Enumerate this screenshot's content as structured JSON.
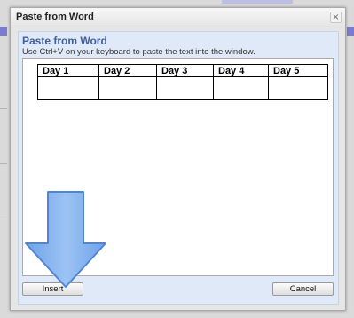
{
  "dialog": {
    "title": "Paste from Word",
    "close_glyph": "×",
    "heading": "Paste from Word",
    "instructions": "Use Ctrl+V on your keyboard to paste the text into the window."
  },
  "table": {
    "headers": [
      "Day 1",
      "Day 2",
      "Day 3",
      "Day 4",
      "Day 5"
    ],
    "rows": [
      [
        "",
        "",
        "",
        "",
        ""
      ]
    ]
  },
  "buttons": {
    "insert_label": "Insert",
    "cancel_label": "Cancel"
  },
  "annotation": {
    "arrow_icon": "down-arrow-icon",
    "arrow_color": "#7fb0ee"
  }
}
